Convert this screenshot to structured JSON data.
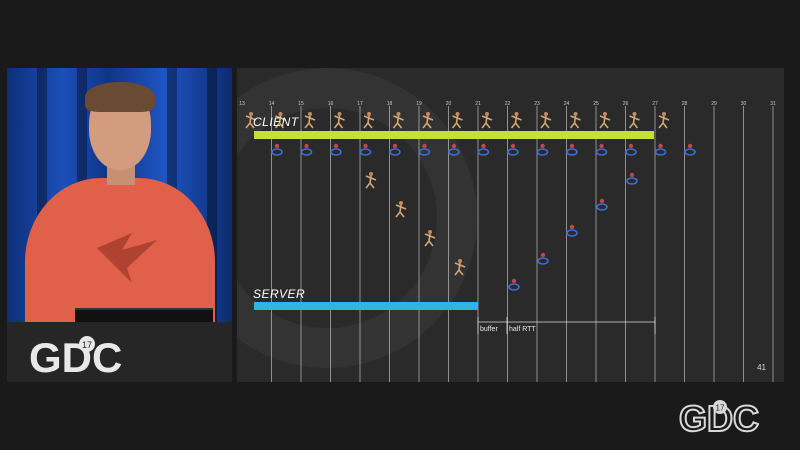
{
  "slide": {
    "client_label": "CLIENT",
    "server_label": "SERVER",
    "buffer_label": "buffer",
    "half_rtt_label": "half RTT",
    "page_number": "41",
    "tick_numbers": [
      "13",
      "14",
      "15",
      "16",
      "17",
      "18",
      "19",
      "20",
      "21",
      "22",
      "23",
      "24",
      "25",
      "26",
      "27",
      "28",
      "29",
      "30",
      "31"
    ]
  },
  "colors": {
    "client_bar": "#c6e03a",
    "server_bar": "#2bb6e6",
    "slide_bg": "#2a2a2a",
    "gridline": "#d6d6d6"
  },
  "logos": {
    "podium_text": "GDC",
    "corner_text": "GDC",
    "edition": "17"
  }
}
